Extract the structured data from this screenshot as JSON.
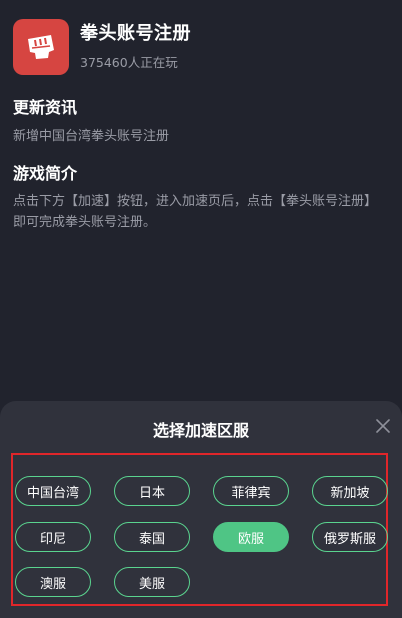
{
  "app": {
    "title": "拳头账号注册",
    "players": "375460人正在玩"
  },
  "news": {
    "title": "更新资讯",
    "text": "新增中国台湾拳头账号注册"
  },
  "intro": {
    "title": "游戏简介",
    "text": "点击下方【加速】按钮，进入加速页后，点击【拳头账号注册】即可完成拳头账号注册。"
  },
  "sheet": {
    "title": "选择加速区服",
    "servers": [
      {
        "label": "中国台湾",
        "selected": false
      },
      {
        "label": "日本",
        "selected": false
      },
      {
        "label": "菲律宾",
        "selected": false
      },
      {
        "label": "新加坡",
        "selected": false
      },
      {
        "label": "印尼",
        "selected": false
      },
      {
        "label": "泰国",
        "selected": false
      },
      {
        "label": "欧服",
        "selected": true
      },
      {
        "label": "俄罗斯服",
        "selected": false
      },
      {
        "label": "澳服",
        "selected": false
      },
      {
        "label": "美服",
        "selected": false
      }
    ]
  },
  "colors": {
    "background": "#21232d",
    "sheet": "#30323c",
    "accent": "#4fc585",
    "highlight_border": "#e0262a",
    "logo": "#d64541"
  }
}
